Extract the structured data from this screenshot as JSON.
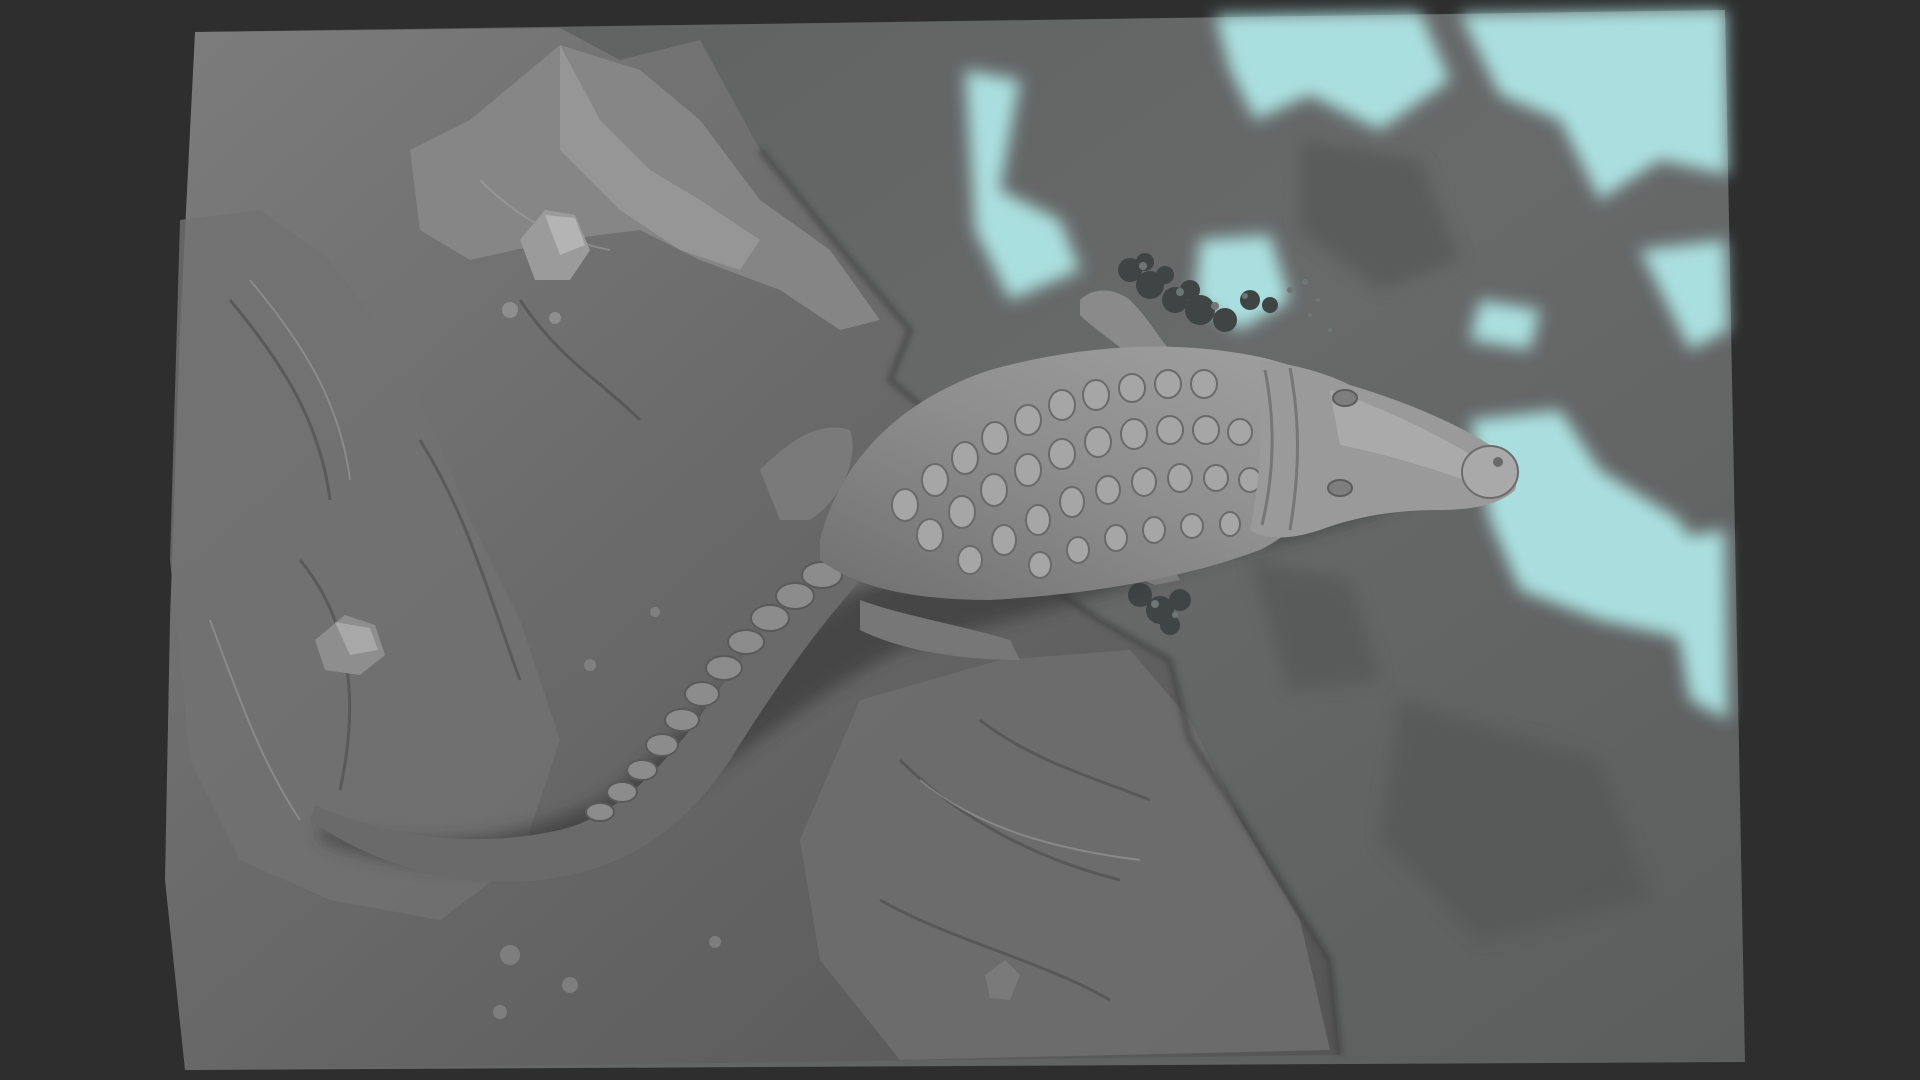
{
  "viewport": {
    "background_color": "#2e2e2e",
    "model_color": "#8a8a8a",
    "water_highlight_color": "#b8f6f6",
    "subject": "crocodile-sculpt"
  },
  "icons": {
    "crocodile": "crocodile-sculpt",
    "rock": "rock-icon",
    "foliage": "foliage-cluster"
  }
}
